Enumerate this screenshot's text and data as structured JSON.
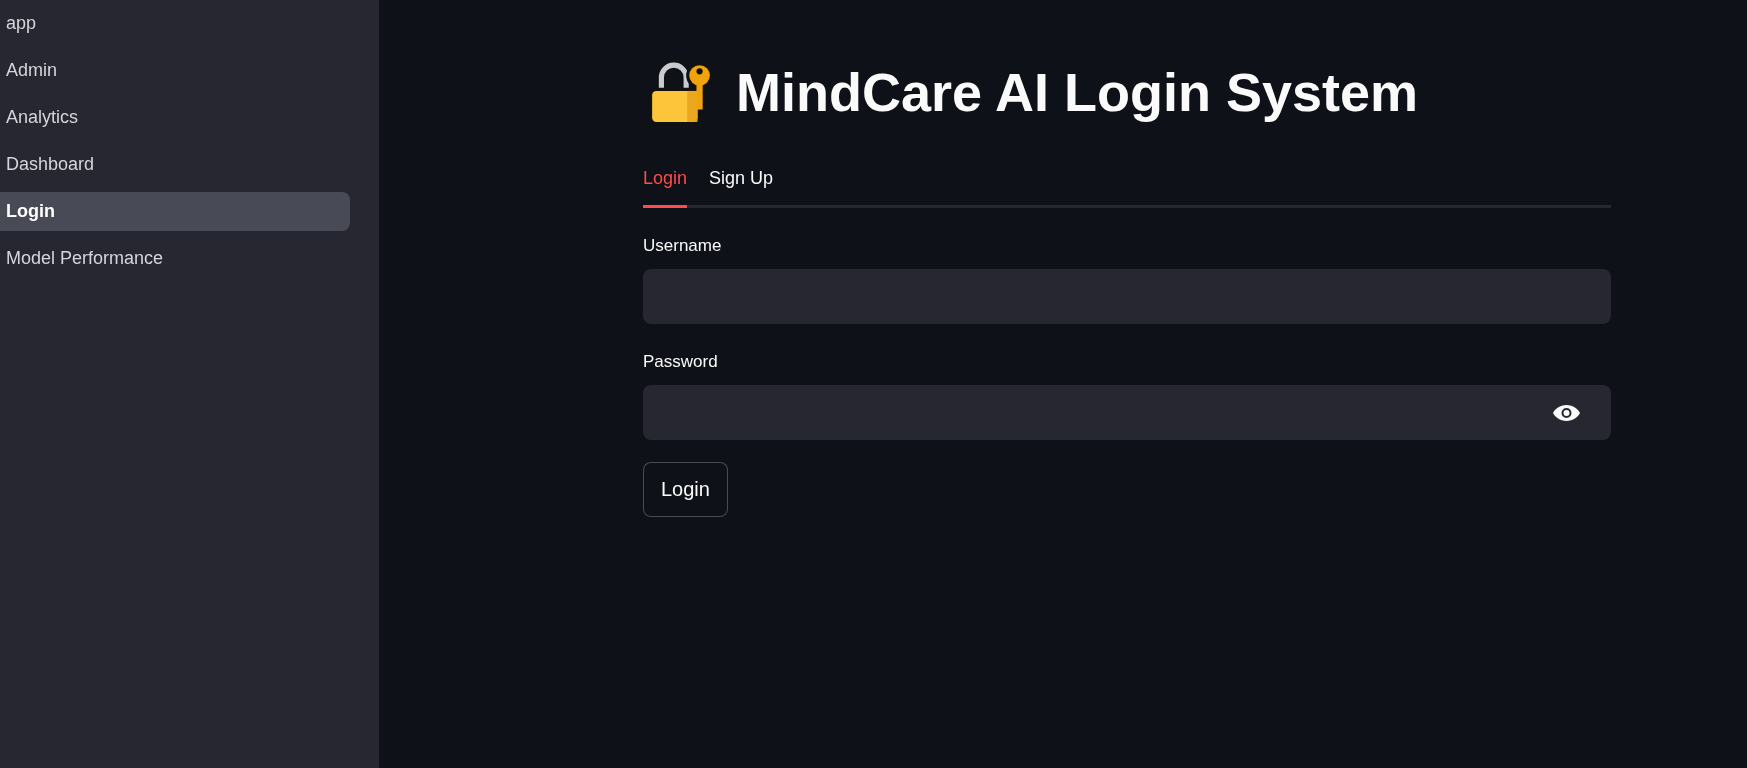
{
  "sidebar": {
    "items": [
      {
        "label": "app",
        "selected": false
      },
      {
        "label": "Admin",
        "selected": false
      },
      {
        "label": "Analytics",
        "selected": false
      },
      {
        "label": "Dashboard",
        "selected": false
      },
      {
        "label": "Login",
        "selected": true
      },
      {
        "label": "Model Performance",
        "selected": false
      }
    ]
  },
  "title": "MindCare AI Login System",
  "tabs": [
    {
      "label": "Login",
      "selected": true
    },
    {
      "label": "Sign Up",
      "selected": false
    }
  ],
  "fields": [
    {
      "label": "Username",
      "kind": "text"
    },
    {
      "label": "Password",
      "kind": "password"
    }
  ],
  "buttons": [
    {
      "label": "Login"
    }
  ]
}
